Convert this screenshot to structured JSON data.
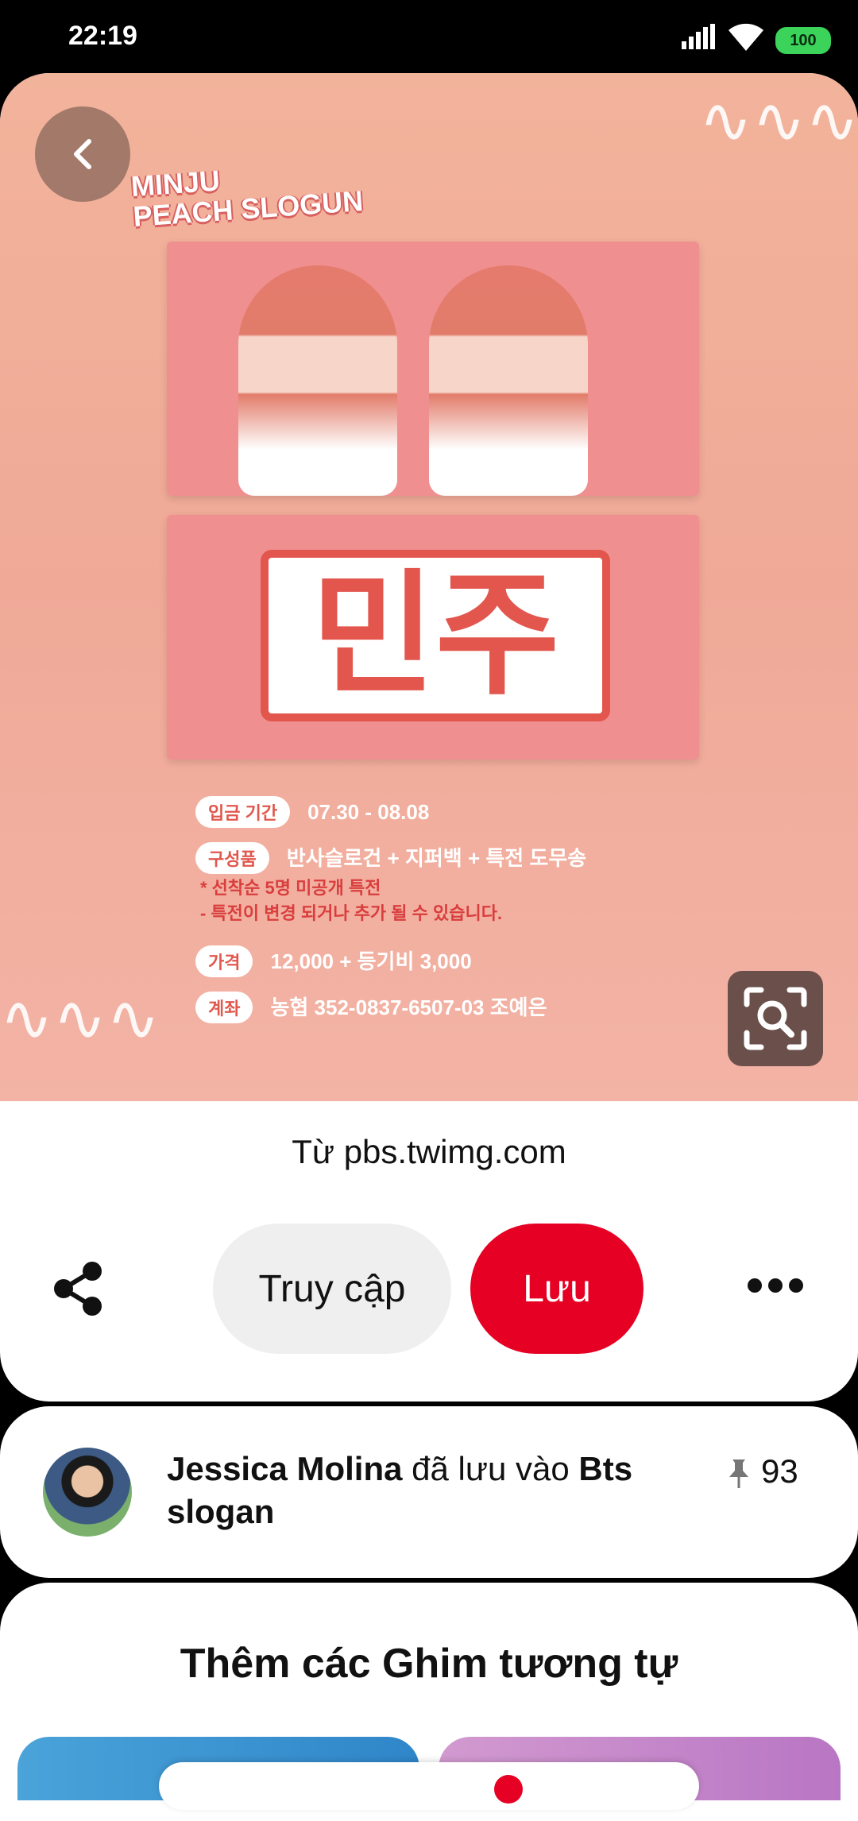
{
  "status_bar": {
    "time": "22:19",
    "battery": "100"
  },
  "pin_image": {
    "title_line1": "MINJU",
    "title_line2": "PEACH SLOGUN",
    "big_text": "민주",
    "rows": [
      {
        "tag": "입금 기간",
        "value": "07.30 - 08.08"
      },
      {
        "tag": "구성품",
        "value": "반사슬로건 + 지퍼백 + 특전 도무송"
      },
      {
        "tag": "가격",
        "value": "12,000 + 등기비 3,000"
      },
      {
        "tag": "계좌",
        "value": "농협 352-0837-6507-03 조예은"
      }
    ],
    "note_line1": "* 선착순 5명 미공개 특전",
    "note_line2": "- 특전이 변경 되거나 추가 될 수 있습니다."
  },
  "source": {
    "prefix": "Từ",
    "domain": "pbs.twimg.com"
  },
  "actions": {
    "visit_label": "Truy cập",
    "save_label": "Lưu"
  },
  "saver": {
    "name": "Jessica Molina",
    "verb": "đã lưu vào",
    "board": "Bts slogan",
    "pin_count": "93"
  },
  "more_section": {
    "title": "Thêm các Ghim tương tự"
  },
  "colors": {
    "accent": "#e60023",
    "hero": "#f2b39b",
    "visit_bg": "#efefef"
  },
  "icons": [
    "back-icon",
    "visual-search-icon",
    "share-icon",
    "more-icon",
    "pin-icon"
  ]
}
